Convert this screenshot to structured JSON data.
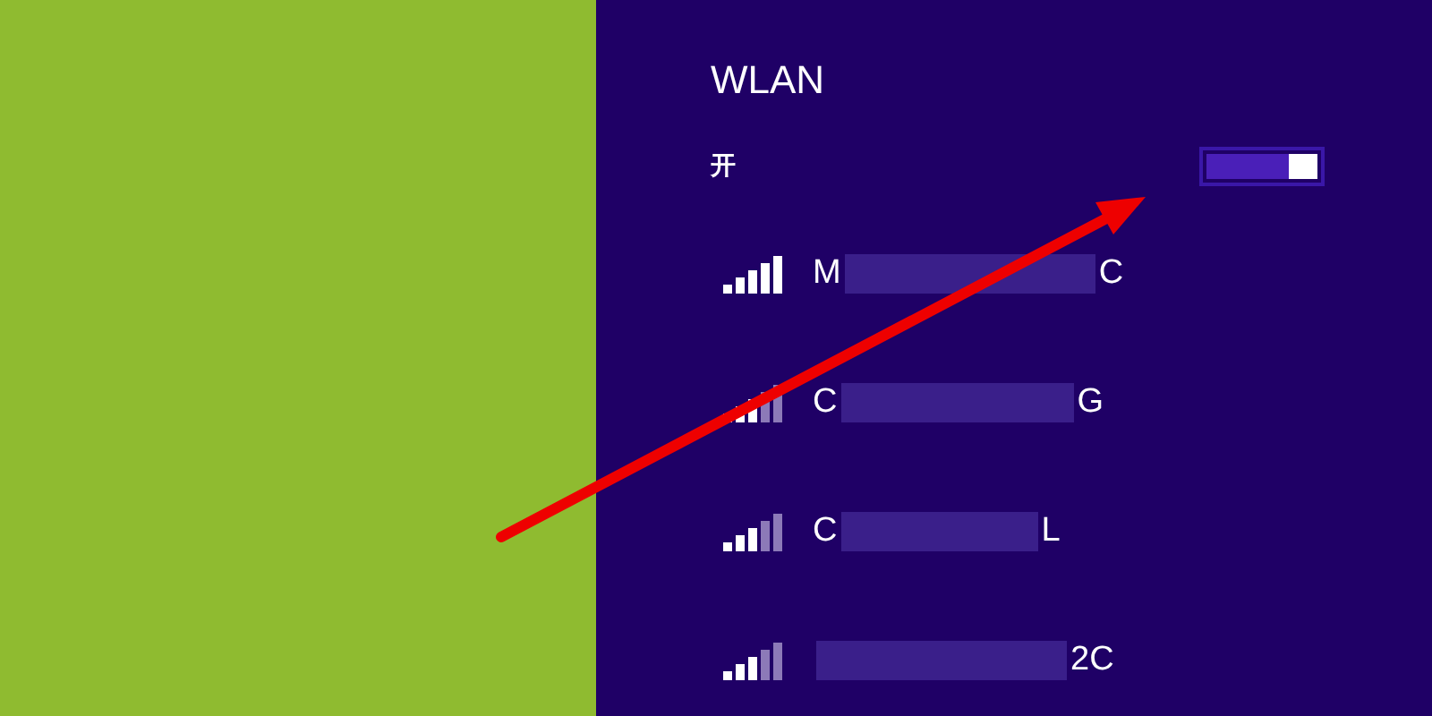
{
  "panel": {
    "title": "WLAN"
  },
  "wifi_switch": {
    "label": "开",
    "on": true
  },
  "networks": [
    {
      "name_start": "M",
      "name_end": "C",
      "kind": "strong"
    },
    {
      "name_start": "C",
      "name_end": "G",
      "kind": "medium"
    },
    {
      "name_start": "C",
      "name_end": "L",
      "kind": "medium"
    },
    {
      "name_end": "2C",
      "kind": "medium"
    }
  ]
}
